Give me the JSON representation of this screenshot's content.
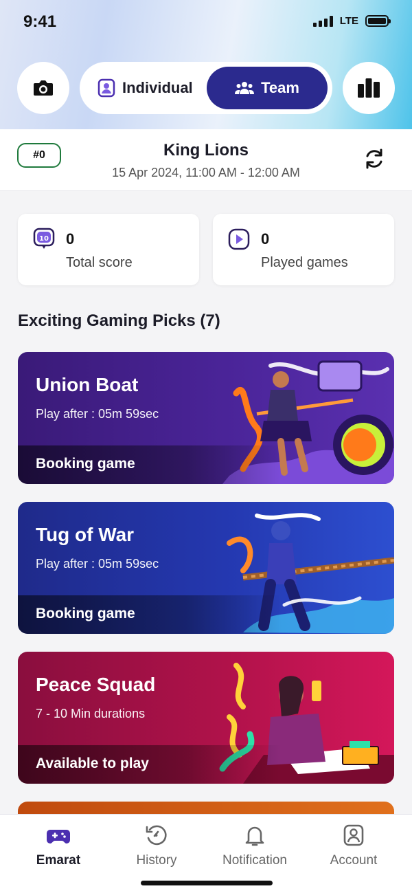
{
  "status_bar": {
    "time": "9:41",
    "network": "LTE"
  },
  "header": {
    "camera_icon": "camera-icon",
    "leaderboard_icon": "leaderboard-icon",
    "segments": {
      "individual": "Individual",
      "team": "Team",
      "active": "Team"
    }
  },
  "team": {
    "rank": "#0",
    "name": "King Lions",
    "date": "15 Apr 2024, 11:00 AM - 12:00 AM"
  },
  "stats": [
    {
      "value": "0",
      "label": "Total score",
      "icon": "score-icon",
      "icon_text": "10"
    },
    {
      "value": "0",
      "label": "Played games",
      "icon": "play-icon"
    }
  ],
  "section": {
    "title": "Exciting Gaming Picks (7)"
  },
  "games": [
    {
      "title": "Union Boat",
      "subtitle": "Play after : 05m 59sec",
      "status": "Booking game",
      "color": "#4a2498"
    },
    {
      "title": "Tug of War",
      "subtitle": "Play after : 05m 59sec",
      "status": "Booking game",
      "color": "#2438b0"
    },
    {
      "title": "Peace Squad",
      "subtitle": "7 - 10 Min durations",
      "status": "Available to play",
      "color": "#b0124a"
    }
  ],
  "tabs": [
    {
      "label": "Emarat",
      "icon": "gamepad-icon",
      "active": true
    },
    {
      "label": "History",
      "icon": "history-icon",
      "active": false
    },
    {
      "label": "Notification",
      "icon": "bell-icon",
      "active": false
    },
    {
      "label": "Account",
      "icon": "account-icon",
      "active": false
    }
  ],
  "colors": {
    "accent": "#2b2a8e",
    "active_tab_icon": "#4b2fb0",
    "rank_border": "#1f7a3c"
  }
}
